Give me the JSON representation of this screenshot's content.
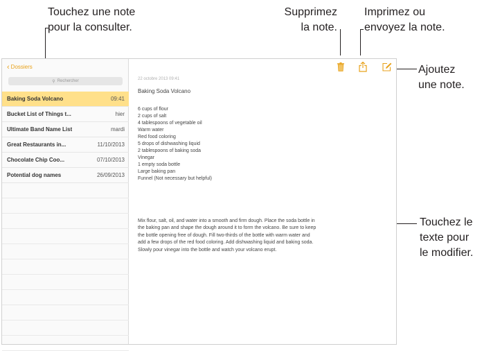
{
  "callouts": {
    "consult": [
      "Touchez une note",
      "pour la consulter."
    ],
    "delete": [
      "Supprimez",
      "la note."
    ],
    "print": [
      "Imprimez ou",
      "envoyez la note."
    ],
    "add": [
      "Ajoutez",
      "une note."
    ],
    "edit": [
      "Touchez le",
      "texte pour",
      "le modifier."
    ]
  },
  "sidebar": {
    "back_label": "Dossiers",
    "search_placeholder": "Rechercher",
    "notes": [
      {
        "title": "Baking Soda Volcano",
        "date": "09:41",
        "selected": true
      },
      {
        "title": "Bucket List of Things t...",
        "date": "hier"
      },
      {
        "title": "Ultimate Band Name List",
        "date": "mardi"
      },
      {
        "title": "Great Restaurants in...",
        "date": "11/10/2013"
      },
      {
        "title": "Chocolate Chip Coo...",
        "date": "07/10/2013"
      },
      {
        "title": "Potential dog names",
        "date": "26/09/2013"
      }
    ]
  },
  "note": {
    "date": "22 octobre 2013 09:41",
    "title": "Baking Soda Volcano",
    "ingredients": [
      "6 cups of flour",
      "2 cups of salt",
      "4 tablespoons of vegetable oil",
      "Warm water",
      "Red food coloring",
      "5 drops of dishwashing liquid",
      "2 tablespoons of baking soda",
      "Vinegar",
      "1 empty soda bottle",
      "Large baking pan",
      "Funnel (Not necessary but helpful)"
    ],
    "paragraph_lines": [
      "Mix flour, salt, oil, and water into a smooth and firm dough.  Place the soda bottle in",
      "the baking pan and shape the dough around it to form the volcano.  Be sure to keep",
      "the bottle opening free of dough.  Fill two-thirds of the bottle with warm water and",
      "add a few drops of the red food coloring. Add dishwashing liquid and baking soda.",
      "Slowly pour vinegar into the bottle and watch your volcano erupt."
    ]
  },
  "icons": {
    "trash": "trash-icon",
    "share": "share-icon",
    "compose": "compose-icon"
  },
  "colors": {
    "accent": "#e8a21b",
    "selected_row": "#ffe08a"
  }
}
